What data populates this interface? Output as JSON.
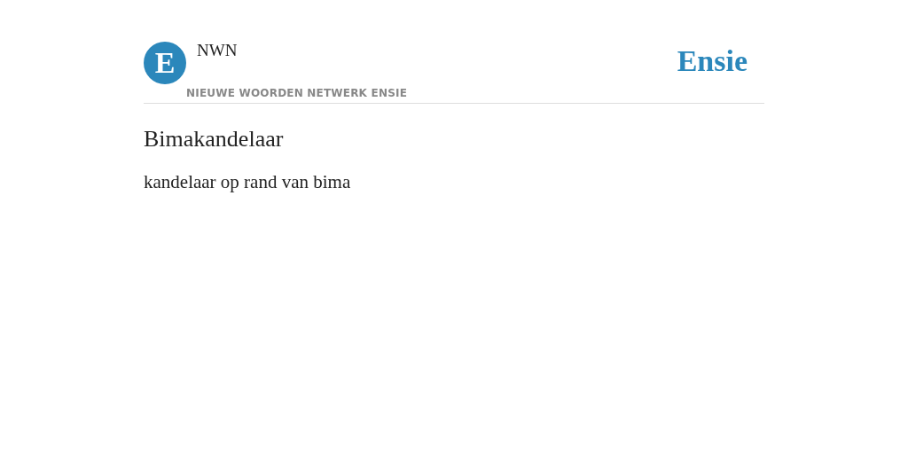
{
  "header": {
    "logo_letter": "E",
    "site_name": "NWN",
    "tagline": "NIEUWE WOORDEN NETWERK ENSIE",
    "brand": "Ensie"
  },
  "entry": {
    "title": "Bimakandelaar",
    "definition": "kandelaar op rand van bima"
  }
}
